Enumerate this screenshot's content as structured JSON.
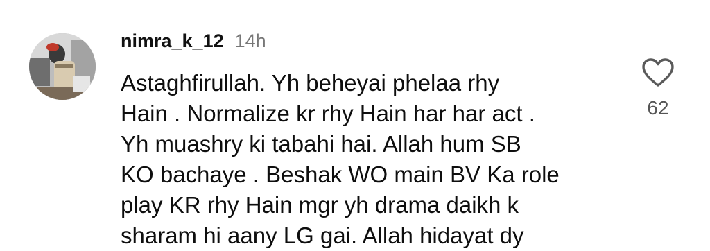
{
  "comment": {
    "username": "nimra_k_12",
    "time": "14h",
    "lines": [
      "Astaghfirullah. Yh beheyai phelaa rhy",
      "Hain . Normalize kr rhy Hain har har act .",
      "Yh muashry ki tabahi hai.  Allah hum SB",
      "KO bachaye . Beshak WO main BV Ka role",
      "play KR rhy Hain mgr yh drama daikh k",
      "sharam hi aany LG gai. Allah hidayat dy"
    ],
    "like_count": "62",
    "like_icon": "heart-outline-icon"
  }
}
